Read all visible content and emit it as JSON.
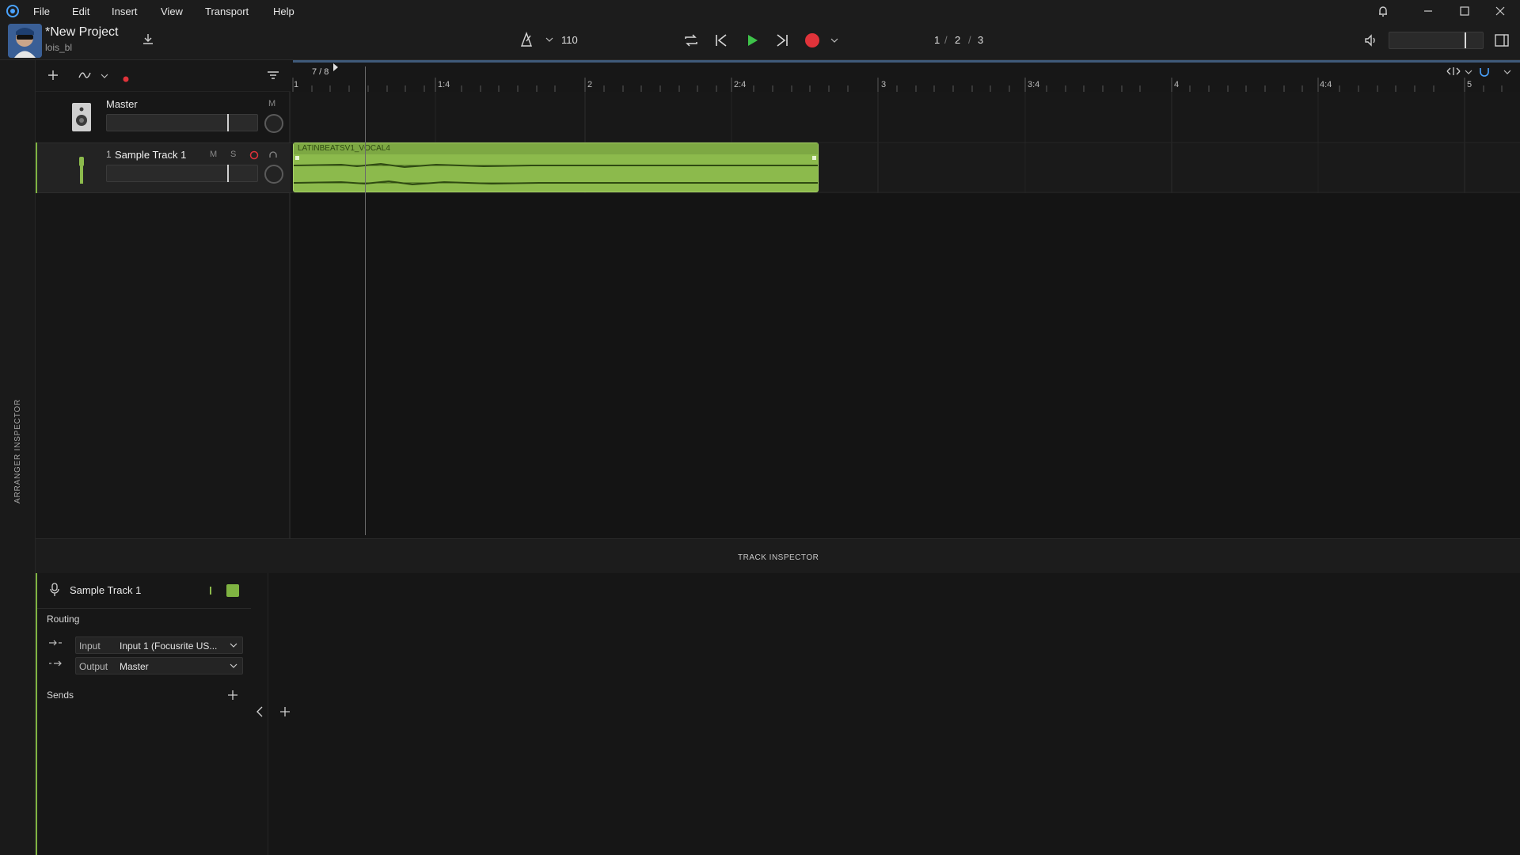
{
  "menu": {
    "items": [
      "File",
      "Edit",
      "Insert",
      "View",
      "Transport",
      "Help"
    ]
  },
  "project": {
    "title": "*New Project",
    "user": "lois_bl"
  },
  "transport": {
    "tempo": "110",
    "page_current": "1",
    "page_sep1": "/",
    "page_mid": "2",
    "page_sep2": "/",
    "page_total": "3"
  },
  "ruler": {
    "time_sig": "7 / 8",
    "markers": [
      "1",
      "1:4",
      "2",
      "2:4",
      "3",
      "3:4",
      "4",
      "4:4",
      "5"
    ]
  },
  "tracks": {
    "master": {
      "name": "Master",
      "mute": "M"
    },
    "track1": {
      "number": "1",
      "name": "Sample Track 1",
      "mute": "M",
      "solo": "S"
    }
  },
  "clip": {
    "name": "LATINBEATSV1_VOCAL4"
  },
  "side_label": "ARRANGER INSPECTOR",
  "inspector": {
    "title": "TRACK INSPECTOR",
    "track_name": "Sample Track 1",
    "routing_label": "Routing",
    "input_label": "Input",
    "input_value": "Input 1 (Focusrite US...",
    "output_label": "Output",
    "output_value": "Master",
    "sends_label": "Sends"
  },
  "colors": {
    "accent_green": "#8cba4c",
    "record_red": "#e0333a",
    "play_green": "#3ec34a",
    "background": "#161616"
  },
  "icons": [
    "app-logo-icon",
    "download-icon",
    "metronome-icon",
    "loop-icon",
    "skip-back-icon",
    "play-icon",
    "skip-forward-icon",
    "record-icon",
    "volume-icon",
    "panel-toggle-icon",
    "bell-icon",
    "plus-icon",
    "automation-icon",
    "filter-icon",
    "speaker-icon",
    "microphone-icon",
    "snap-icon",
    "zoom-icon",
    "chevron-left-icon"
  ]
}
